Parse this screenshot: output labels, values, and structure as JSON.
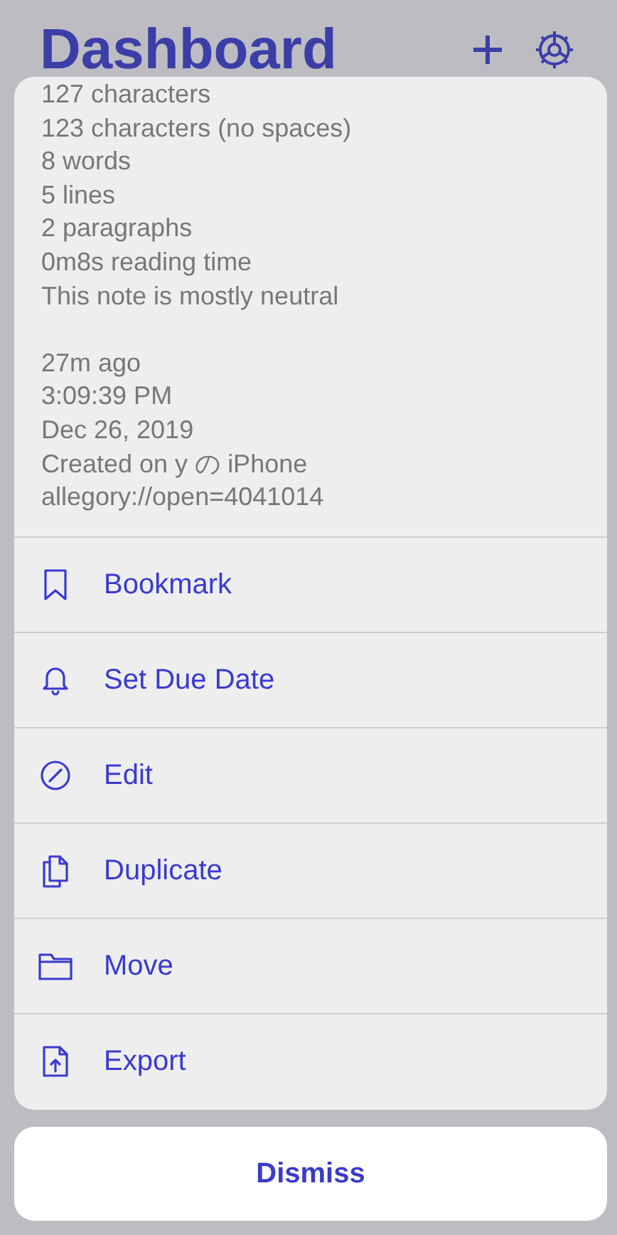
{
  "header": {
    "title": "Dashboard"
  },
  "info": {
    "stats": [
      "127 characters",
      "123 characters (no spaces)",
      "8 words",
      "5 lines",
      "2 paragraphs",
      "0m8s reading time",
      "This note is mostly neutral"
    ],
    "details": [
      "27m ago",
      "3:09:39 PM",
      "Dec 26, 2019",
      "Created on y の iPhone",
      "allegory://open=4041014"
    ]
  },
  "actions": [
    {
      "kind": "bookmark",
      "label": "Bookmark"
    },
    {
      "kind": "bell",
      "label": "Set Due Date"
    },
    {
      "kind": "edit",
      "label": "Edit"
    },
    {
      "kind": "duplicate",
      "label": "Duplicate"
    },
    {
      "kind": "folder",
      "label": "Move"
    },
    {
      "kind": "export",
      "label": "Export"
    }
  ],
  "dismiss": "Dismiss"
}
